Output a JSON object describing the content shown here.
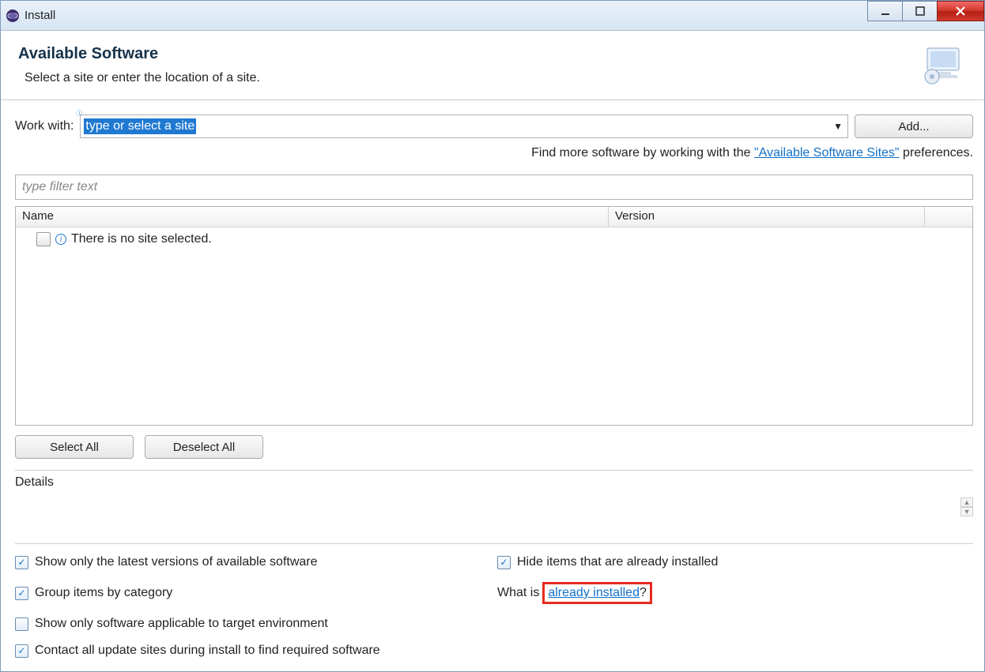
{
  "window": {
    "title": "Install"
  },
  "header": {
    "title": "Available Software",
    "subtitle": "Select a site or enter the location of a site."
  },
  "workwith": {
    "label": "Work with:",
    "placeholder": "type or select a site",
    "add_label": "Add..."
  },
  "findmore": {
    "prefix": "Find more software by working with the ",
    "link": "\"Available Software Sites\"",
    "suffix": " preferences."
  },
  "filter": {
    "placeholder": "type filter text"
  },
  "table": {
    "col_name": "Name",
    "col_version": "Version",
    "empty_msg": "There is no site selected."
  },
  "selection": {
    "select_all": "Select All",
    "deselect_all": "Deselect All"
  },
  "details": {
    "label": "Details"
  },
  "options": {
    "show_latest": "Show only the latest versions of available software",
    "group_by_category": "Group items by category",
    "show_applicable": "Show only software applicable to target environment",
    "contact_sites": "Contact all update sites during install to find required software",
    "hide_installed": "Hide items that are already installed",
    "what_is_prefix": "What is ",
    "already_installed": "already installed",
    "what_is_suffix": "?"
  }
}
